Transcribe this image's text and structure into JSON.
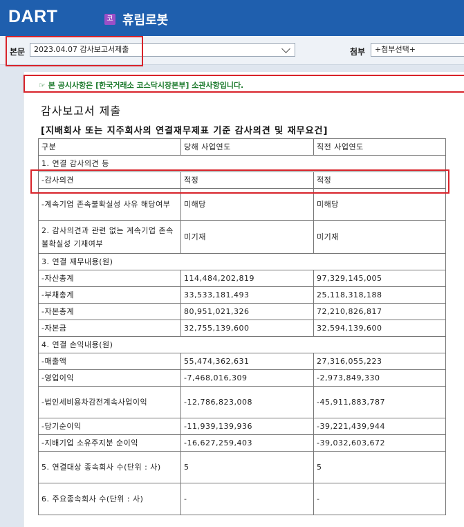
{
  "header": {
    "logo": "DART",
    "market_badge": "코",
    "company_name": "휴림로봇"
  },
  "toolbar": {
    "body_label": "본문",
    "body_select_value": "2023.04.07  감사보고서제출",
    "attach_label": "첨부",
    "attach_select_value": "+첨부선택+"
  },
  "document": {
    "notice": "☞ 본 공시사항은 [한국거래소 코스닥시장본부] 소관사항입니다.",
    "title": "감사보고서 제출",
    "subtitle": "[지배회사 또는 지주회사의 연결재무제표 기준 감사의견 및 재무요건]",
    "columns": [
      "구분",
      "당해 사업연도",
      "직전 사업연도"
    ],
    "rows": [
      {
        "label": "1. 연결 감사의견 등",
        "current": "",
        "prior": "",
        "section": true
      },
      {
        "label": "-감사의견",
        "current": "적정",
        "prior": "적정"
      },
      {
        "label": "-계속기업 존속불확실성 사유 해당여부",
        "current": "미해당",
        "prior": "미해당"
      },
      {
        "label": "2. 감사의견과 관련 없는 계속기업 존속 불확실성 기재여부",
        "current": "미기재",
        "prior": "미기재"
      },
      {
        "label": "3. 연결 재무내용(원)",
        "current": "",
        "prior": "",
        "section": true
      },
      {
        "label": "-자산총계",
        "current": "114,484,202,819",
        "prior": "97,329,145,005"
      },
      {
        "label": "-부채총계",
        "current": "33,533,181,493",
        "prior": "25,118,318,188"
      },
      {
        "label": "-자본총계",
        "current": "80,951,021,326",
        "prior": "72,210,826,817"
      },
      {
        "label": "-자본금",
        "current": "32,755,139,600",
        "prior": "32,594,139,600"
      },
      {
        "label": "4. 연결 손익내용(원)",
        "current": "",
        "prior": "",
        "section": true
      },
      {
        "label": "-매출액",
        "current": "55,474,362,631",
        "prior": "27,316,055,223"
      },
      {
        "label": "-영업이익",
        "current": "-7,468,016,309",
        "prior": "-2,973,849,330"
      },
      {
        "label": "-법인세비용차감전계속사업이익",
        "current": "-12,786,823,008",
        "prior": "-45,911,883,787"
      },
      {
        "label": "-당기순이익",
        "current": "-11,939,139,936",
        "prior": "-39,221,439,944"
      },
      {
        "label": "-지배기업 소유주지분 순이익",
        "current": "-16,627,259,403",
        "prior": "-39,032,603,672"
      },
      {
        "label": "5. 연결대상 종속회사 수(단위 : 사)",
        "current": "5",
        "prior": "5"
      },
      {
        "label": "6. 주요종속회사 수(단위 : 사)",
        "current": "-",
        "prior": "-"
      }
    ]
  }
}
